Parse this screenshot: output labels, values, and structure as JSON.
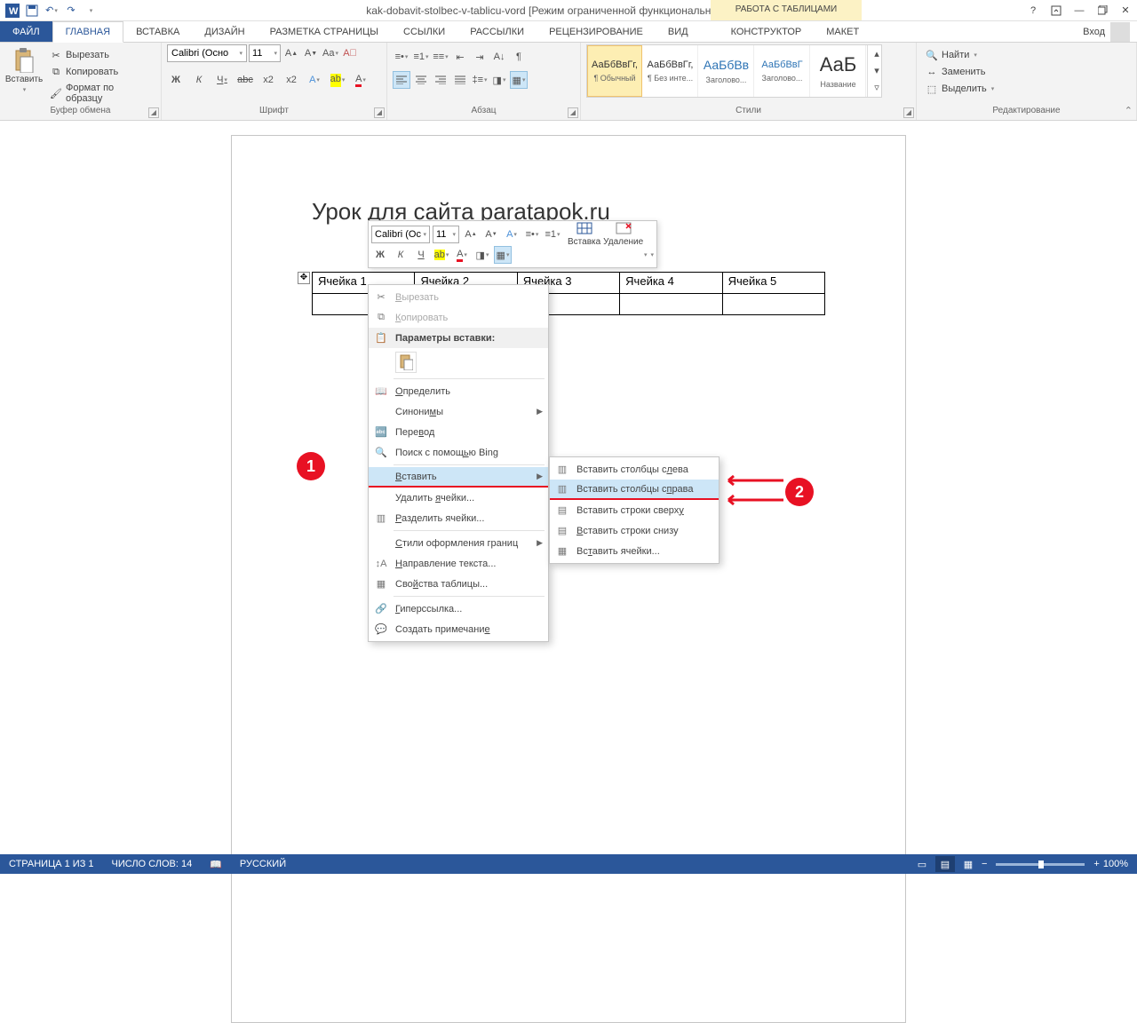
{
  "title": "kak-dobavit-stolbec-v-tablicu-vord [Режим ограниченной функциональности] - Word",
  "table_tools_label": "РАБОТА С ТАБЛИЦАМИ",
  "login_label": "Вход",
  "tabs": {
    "file": "ФАЙЛ",
    "home": "ГЛАВНАЯ",
    "insert": "ВСТАВКА",
    "design": "ДИЗАЙН",
    "layout": "РАЗМЕТКА СТРАНИЦЫ",
    "references": "ССЫЛКИ",
    "mailings": "РАССЫЛКИ",
    "review": "РЕЦЕНЗИРОВАНИЕ",
    "view": "ВИД",
    "constructor": "КОНСТРУКТОР",
    "tlayout": "МАКЕТ"
  },
  "ribbon": {
    "clipboard": {
      "paste": "Вставить",
      "cut": "Вырезать",
      "copy": "Копировать",
      "fmt": "Формат по образцу",
      "label": "Буфер обмена"
    },
    "font": {
      "name": "Calibri (Осно",
      "size": "11",
      "label": "Шрифт"
    },
    "para_label": "Абзац",
    "styles": {
      "label": "Стили",
      "items": [
        {
          "prev": "АаБбВвГг,",
          "name": "¶ Обычный"
        },
        {
          "prev": "АаБбВвГг,",
          "name": "¶ Без инте..."
        },
        {
          "prev": "АаБбВв",
          "name": "Заголово..."
        },
        {
          "prev": "АаБбВвГ",
          "name": "Заголово..."
        },
        {
          "prev": "АаБ",
          "name": "Название"
        }
      ]
    },
    "editing": {
      "find": "Найти",
      "replace": "Заменить",
      "select": "Выделить",
      "label": "Редактирование"
    }
  },
  "doc": {
    "heading": "Урок для сайта paratapok.ru",
    "cells": [
      "Ячейка 1",
      "Ячейка 2",
      "Ячейка 3",
      "Ячейка 4",
      "Ячейка 5"
    ]
  },
  "minibar": {
    "font": "Calibri (Ос",
    "size": "11",
    "insert": "Вставка",
    "delete": "Удаление"
  },
  "ctx": {
    "cut": "Вырезать",
    "copy": "Копировать",
    "paste_header": "Параметры вставки:",
    "define": "Определить",
    "synonyms": "Синонимы",
    "translate": "Перевод",
    "bing": "Поиск с помощью Bing",
    "insert": "Вставить",
    "delete_cells": "Удалить ячейки...",
    "split": "Разделить ячейки...",
    "border_styles": "Стили оформления границ",
    "text_dir": "Направление текста...",
    "props": "Свойства таблицы...",
    "hyperlink": "Гиперссылка...",
    "comment": "Создать примечание"
  },
  "submenu": {
    "cols_left": "Вставить столбцы слева",
    "cols_right": "Вставить столбцы справа",
    "rows_above": "Вставить строки сверху",
    "rows_below": "Вставить строки снизу",
    "cells": "Вставить ячейки..."
  },
  "badges": {
    "one": "1",
    "two": "2"
  },
  "status": {
    "page": "СТРАНИЦА 1 ИЗ 1",
    "words": "ЧИСЛО СЛОВ: 14",
    "lang": "РУССКИЙ",
    "zoom": "100%"
  }
}
